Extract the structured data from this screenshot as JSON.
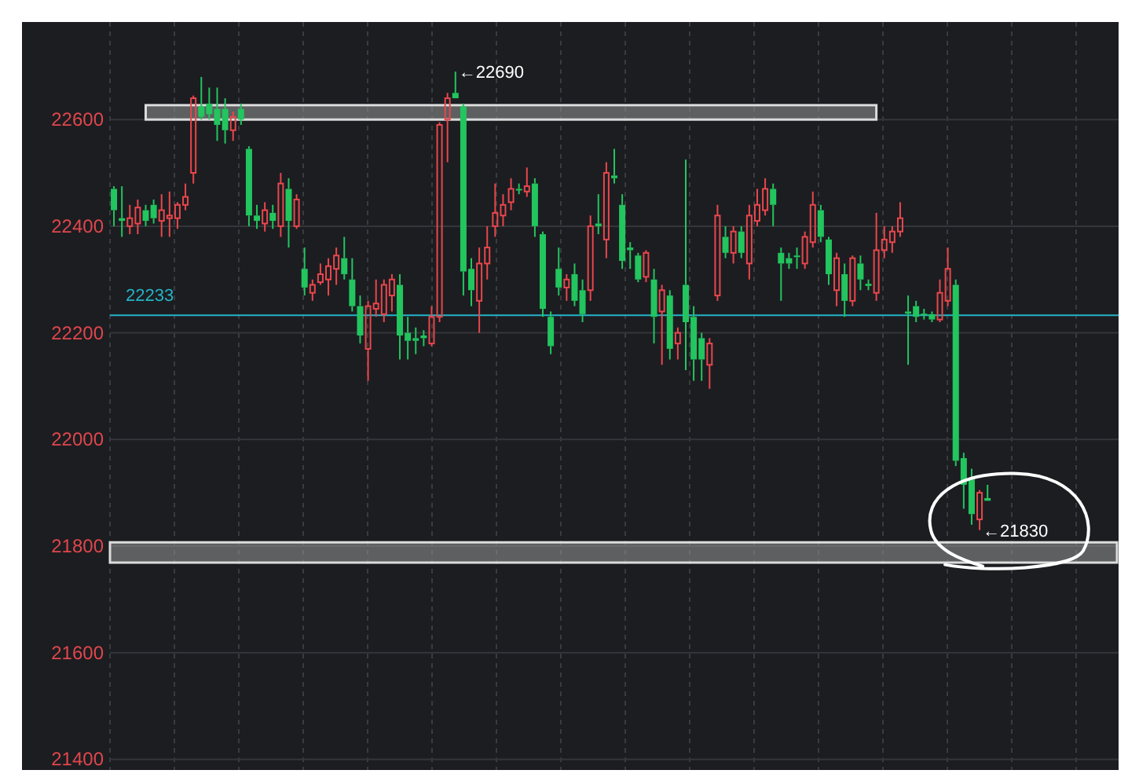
{
  "chart_data": {
    "type": "candlestick",
    "ylim": [
      21380,
      22783
    ],
    "grid": true,
    "yticks": [
      21400,
      21600,
      21800,
      22000,
      22200,
      22400,
      22600
    ],
    "ohlc": [
      [
        22470,
        22475,
        22400,
        22430
      ],
      [
        22415,
        22475,
        22380,
        22410
      ],
      [
        22400,
        22440,
        22385,
        22415
      ],
      [
        22405,
        22450,
        22385,
        22435
      ],
      [
        22430,
        22440,
        22400,
        22410
      ],
      [
        22440,
        22450,
        22405,
        22415
      ],
      [
        22410,
        22460,
        22380,
        22430
      ],
      [
        22415,
        22465,
        22380,
        22420
      ],
      [
        22415,
        22445,
        22395,
        22440
      ],
      [
        22440,
        22480,
        22430,
        22455
      ],
      [
        22500,
        22645,
        22480,
        22640
      ],
      [
        22625,
        22680,
        22600,
        22605
      ],
      [
        22630,
        22660,
        22600,
        22610
      ],
      [
        22620,
        22660,
        22560,
        22590
      ],
      [
        22620,
        22640,
        22555,
        22580
      ],
      [
        22580,
        22615,
        22560,
        22605
      ],
      [
        22620,
        22630,
        22590,
        22600
      ],
      [
        22545,
        22550,
        22400,
        22420
      ],
      [
        22420,
        22440,
        22395,
        22410
      ],
      [
        22405,
        22445,
        22390,
        22430
      ],
      [
        22425,
        22440,
        22395,
        22410
      ],
      [
        22400,
        22500,
        22380,
        22480
      ],
      [
        22470,
        22490,
        22360,
        22410
      ],
      [
        22400,
        22460,
        22395,
        22450
      ],
      [
        22320,
        22360,
        22270,
        22285
      ],
      [
        22275,
        22300,
        22260,
        22290
      ],
      [
        22295,
        22330,
        22290,
        22310
      ],
      [
        22300,
        22340,
        22270,
        22325
      ],
      [
        22320,
        22360,
        22290,
        22345
      ],
      [
        22340,
        22380,
        22300,
        22310
      ],
      [
        22300,
        22340,
        22240,
        22250
      ],
      [
        22250,
        22270,
        22180,
        22195
      ],
      [
        22170,
        22260,
        22110,
        22250
      ],
      [
        22245,
        22300,
        22230,
        22255
      ],
      [
        22235,
        22300,
        22220,
        22290
      ],
      [
        22270,
        22310,
        22240,
        22300
      ],
      [
        22290,
        22310,
        22150,
        22195
      ],
      [
        22200,
        22230,
        22150,
        22185
      ],
      [
        22190,
        22210,
        22160,
        22185
      ],
      [
        22195,
        22205,
        22175,
        22190
      ],
      [
        22180,
        22250,
        22175,
        22230
      ],
      [
        22230,
        22595,
        22220,
        22590
      ],
      [
        22600,
        22650,
        22520,
        22640
      ],
      [
        22650,
        22690,
        22640,
        22640
      ],
      [
        22625,
        22630,
        22270,
        22315
      ],
      [
        22320,
        22340,
        22250,
        22280
      ],
      [
        22260,
        22360,
        22200,
        22330
      ],
      [
        22330,
        22400,
        22300,
        22360
      ],
      [
        22400,
        22480,
        22380,
        22425
      ],
      [
        22420,
        22460,
        22400,
        22440
      ],
      [
        22445,
        22490,
        22430,
        22470
      ],
      [
        22470,
        22480,
        22460,
        22468
      ],
      [
        22465,
        22510,
        22455,
        22475
      ],
      [
        22480,
        22490,
        22380,
        22400
      ],
      [
        22385,
        22390,
        22230,
        22245
      ],
      [
        22230,
        22240,
        22160,
        22175
      ],
      [
        22320,
        22360,
        22270,
        22285
      ],
      [
        22285,
        22310,
        22260,
        22300
      ],
      [
        22310,
        22330,
        22250,
        22260
      ],
      [
        22280,
        22300,
        22220,
        22235
      ],
      [
        22280,
        22420,
        22260,
        22400
      ],
      [
        22405,
        22460,
        22385,
        22400
      ],
      [
        22375,
        22520,
        22340,
        22500
      ],
      [
        22495,
        22545,
        22480,
        22490
      ],
      [
        22440,
        22460,
        22320,
        22335
      ],
      [
        22360,
        22370,
        22320,
        22355
      ],
      [
        22345,
        22350,
        22295,
        22300
      ],
      [
        22305,
        22355,
        22295,
        22350
      ],
      [
        22300,
        22320,
        22180,
        22230
      ],
      [
        22240,
        22290,
        22140,
        22280
      ],
      [
        22270,
        22280,
        22150,
        22170
      ],
      [
        22180,
        22210,
        22150,
        22200
      ],
      [
        22290,
        22525,
        22130,
        22220
      ],
      [
        22230,
        22250,
        22110,
        22150
      ],
      [
        22190,
        22200,
        22110,
        22150
      ],
      [
        22140,
        22190,
        22095,
        22180
      ],
      [
        22270,
        22440,
        22260,
        22420
      ],
      [
        22380,
        22400,
        22340,
        22350
      ],
      [
        22350,
        22400,
        22330,
        22390
      ],
      [
        22390,
        22400,
        22340,
        22350
      ],
      [
        22330,
        22440,
        22300,
        22420
      ],
      [
        22410,
        22470,
        22400,
        22440
      ],
      [
        22430,
        22490,
        22420,
        22470
      ],
      [
        22470,
        22480,
        22400,
        22440
      ],
      [
        22350,
        22360,
        22260,
        22330
      ],
      [
        22340,
        22350,
        22320,
        22330
      ],
      [
        22345,
        22360,
        22320,
        22342
      ],
      [
        22330,
        22390,
        22320,
        22380
      ],
      [
        22370,
        22465,
        22360,
        22440
      ],
      [
        22430,
        22440,
        22370,
        22380
      ],
      [
        22375,
        22380,
        22290,
        22310
      ],
      [
        22280,
        22350,
        22250,
        22340
      ],
      [
        22310,
        22330,
        22230,
        22260
      ],
      [
        22260,
        22345,
        22250,
        22340
      ],
      [
        22330,
        22345,
        22280,
        22300
      ],
      [
        22292,
        22300,
        22280,
        22288
      ],
      [
        22275,
        22425,
        22260,
        22355
      ],
      [
        22355,
        22400,
        22340,
        22375
      ],
      [
        22370,
        22400,
        22350,
        22390
      ],
      [
        22390,
        22445,
        22380,
        22415
      ],
      [
        22240,
        22270,
        22140,
        22236
      ],
      [
        22250,
        22260,
        22220,
        22230
      ],
      [
        22236,
        22245,
        22225,
        22234
      ],
      [
        22235,
        22240,
        22220,
        22225
      ],
      [
        22225,
        22300,
        22220,
        22275
      ],
      [
        22260,
        22360,
        22250,
        22320
      ],
      [
        22290,
        22300,
        21950,
        21960
      ],
      [
        21965,
        21975,
        21870,
        21915
      ],
      [
        21925,
        21945,
        21840,
        21860
      ],
      [
        21850,
        21905,
        21830,
        21900
      ],
      [
        21890,
        21915,
        21885,
        21885
      ],
      null,
      null,
      null,
      null,
      null,
      null,
      null,
      null,
      null,
      null,
      null,
      null,
      null,
      null,
      null,
      null
    ],
    "bands": [
      {
        "axis": "y",
        "from": 22600,
        "to": 22627
      },
      {
        "axis": "y",
        "from": 21769,
        "to": 21807
      }
    ],
    "ref_lines": [
      {
        "axis": "y",
        "value": 22233,
        "label": "22233",
        "color": "#23b5c8"
      }
    ],
    "annotations": [
      "←22690",
      "←21830"
    ]
  }
}
